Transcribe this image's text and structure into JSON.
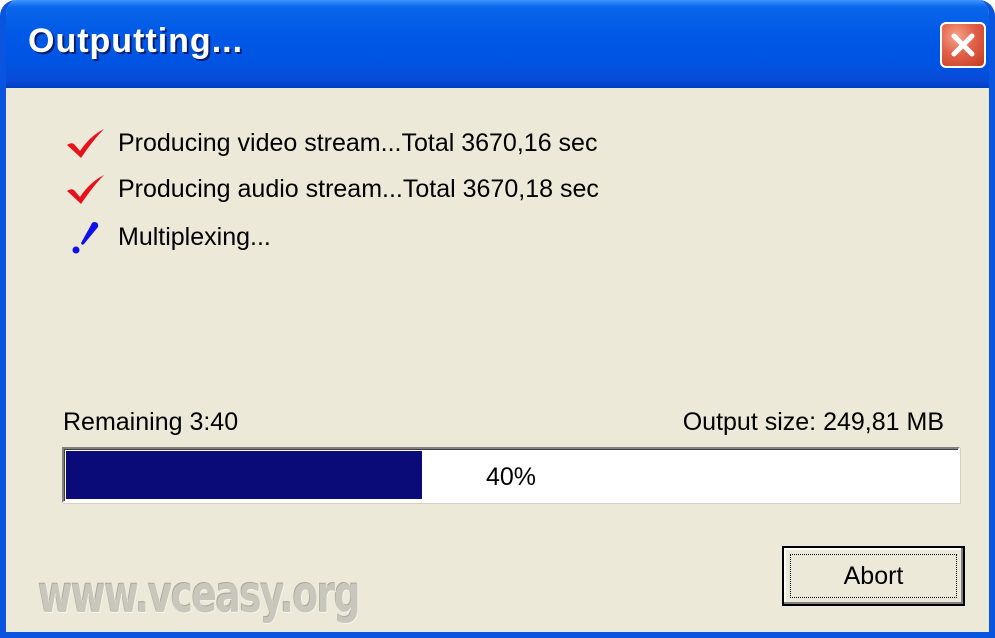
{
  "window": {
    "title": "Outputting...",
    "close_icon": "close-icon"
  },
  "steps": [
    {
      "label": "Producing video stream...Total 3670,16 sec",
      "status": "done",
      "icon": "checkmark-icon",
      "color": "#e8101a"
    },
    {
      "label": "Producing audio stream...Total 3670,18 sec",
      "status": "done",
      "icon": "checkmark-icon",
      "color": "#e8101a"
    },
    {
      "label": "Multiplexing...",
      "status": "in-progress",
      "icon": "exclamation-icon",
      "color": "#1010e8"
    }
  ],
  "status": {
    "remaining": "Remaining 3:40",
    "output_size": "Output size: 249,81 MB"
  },
  "progress": {
    "value": 0.4,
    "label": "40%",
    "fill_color": "#0a0a78"
  },
  "buttons": {
    "abort_label": "Abort"
  },
  "watermark": "www.vceasy.org"
}
